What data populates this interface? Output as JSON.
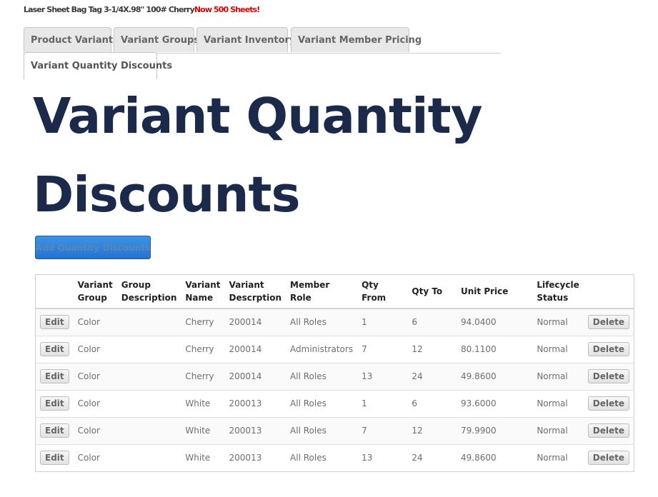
{
  "product": {
    "name": "Laser Sheet Bag Tag 3-1/4X.98\" 100# Cherry",
    "promo": "Now 500 Sheets!"
  },
  "tabs": [
    {
      "label": "Product Variants",
      "active": false
    },
    {
      "label": "Variant Groups",
      "active": false
    },
    {
      "label": "Variant Inventory",
      "active": false
    },
    {
      "label": "Variant Member Pricing",
      "active": false
    },
    {
      "label": "Variant Quantity Discounts",
      "active": true
    }
  ],
  "page": {
    "title": "Variant Quantity Discounts",
    "add_button": "Add Quantity Discounts"
  },
  "table": {
    "headers": {
      "variant_group": "Variant Group",
      "group_description": "Group Description",
      "variant_name": "Variant Name",
      "variant_description": "Variant Descrption",
      "member_role": "Member Role",
      "qty_from": "Qty From",
      "qty_to": "Qty To",
      "unit_price": "Unit Price",
      "lifecycle_status": "Lifecycle Status"
    },
    "edit_label": "Edit",
    "delete_label": "Delete",
    "rows": [
      {
        "variant_group": "Color",
        "group_description": "",
        "variant_name": "Cherry",
        "variant_description": "200014",
        "member_role": "All Roles",
        "qty_from": "1",
        "qty_to": "6",
        "unit_price": "94.0400",
        "lifecycle_status": "Normal"
      },
      {
        "variant_group": "Color",
        "group_description": "",
        "variant_name": "Cherry",
        "variant_description": "200014",
        "member_role": "Administrators",
        "qty_from": "7",
        "qty_to": "12",
        "unit_price": "80.1100",
        "lifecycle_status": "Normal"
      },
      {
        "variant_group": "Color",
        "group_description": "",
        "variant_name": "Cherry",
        "variant_description": "200014",
        "member_role": "All Roles",
        "qty_from": "13",
        "qty_to": "24",
        "unit_price": "49.8600",
        "lifecycle_status": "Normal"
      },
      {
        "variant_group": "Color",
        "group_description": "",
        "variant_name": "White",
        "variant_description": "200013",
        "member_role": "All Roles",
        "qty_from": "1",
        "qty_to": "6",
        "unit_price": "93.6000",
        "lifecycle_status": "Normal"
      },
      {
        "variant_group": "Color",
        "group_description": "",
        "variant_name": "White",
        "variant_description": "200013",
        "member_role": "All Roles",
        "qty_from": "7",
        "qty_to": "12",
        "unit_price": "79.9900",
        "lifecycle_status": "Normal"
      },
      {
        "variant_group": "Color",
        "group_description": "",
        "variant_name": "White",
        "variant_description": "200013",
        "member_role": "All Roles",
        "qty_from": "13",
        "qty_to": "24",
        "unit_price": "49.8600",
        "lifecycle_status": "Normal"
      }
    ]
  }
}
